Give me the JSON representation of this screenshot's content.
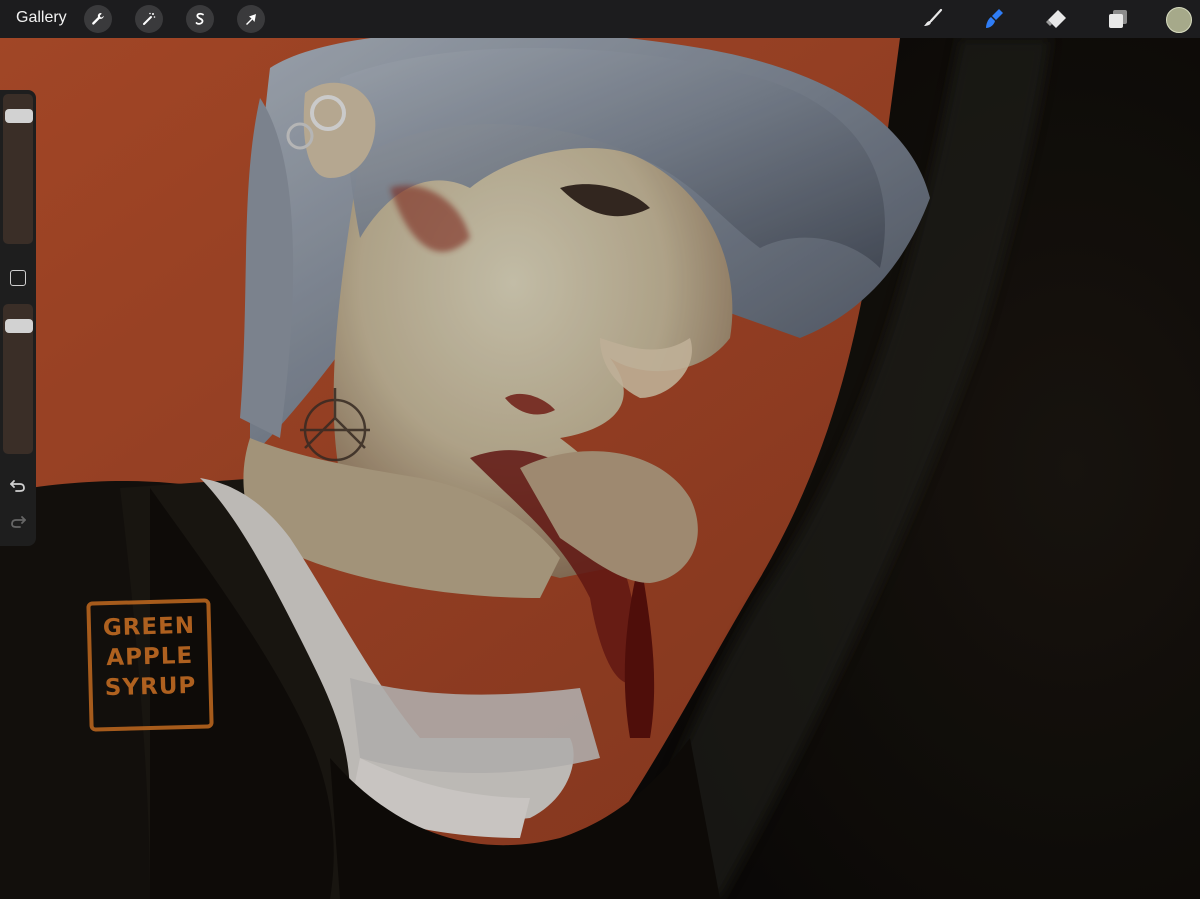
{
  "app": {
    "gallery_label": "Gallery"
  },
  "toolbar": {
    "left_tools": [
      {
        "name": "wrench-icon",
        "label": "Actions"
      },
      {
        "name": "magic-wand-icon",
        "label": "Adjustments"
      },
      {
        "name": "selection-icon",
        "label": "Selection"
      },
      {
        "name": "arrow-icon",
        "label": "Transform"
      }
    ],
    "right_tools": [
      {
        "name": "brush-icon",
        "label": "Paint"
      },
      {
        "name": "smudge-icon",
        "label": "Smudge",
        "active": true
      },
      {
        "name": "eraser-icon",
        "label": "Erase"
      },
      {
        "name": "layers-icon",
        "label": "Layers"
      }
    ],
    "current_color": "#a6a98a",
    "accent_color": "#2f7df6"
  },
  "sidebar": {
    "brush_size_level": 0.1,
    "opacity_level": 0.1
  },
  "artwork": {
    "signature_lines": [
      "GREEN",
      "APPLE",
      "SYRUP"
    ]
  }
}
